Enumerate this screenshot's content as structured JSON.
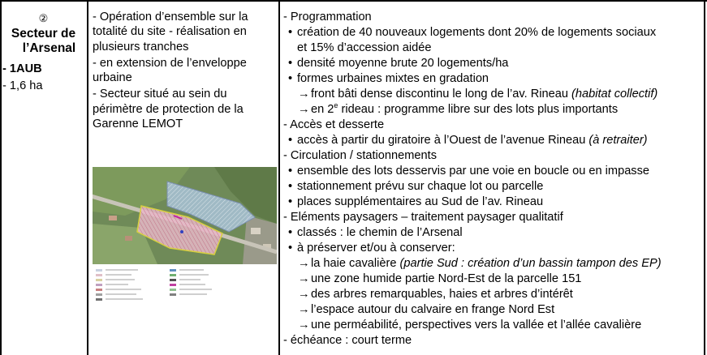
{
  "col1": {
    "number": "②",
    "title_line1": "Secteur de",
    "title_line2": "l’Arsenal",
    "zone": "- 1AUB",
    "area": "- 1,6 ha"
  },
  "col2": {
    "p1": "- Opération d’ensemble sur la totalité du site - réalisation en plusieurs tranches",
    "p2": "- en extension de l’enveloppe urbaine",
    "p3": "- Secteur situé au sein du périmètre de protection de la Garenne LEMOT"
  },
  "col3": {
    "programmation": {
      "heading": "- Programmation",
      "b1_line1": "création de 40 nouveaux logements dont 20% de logements sociaux",
      "b1_line2": "et 15% d’accession aidée",
      "b2": "densité moyenne brute 20 logements/ha",
      "b3": "formes urbaines mixtes en gradation",
      "a1_text": "front bâti dense discontinu le long de l’av. Rineau ",
      "a1_italic": "(habitat collectif)",
      "a2_pre": "en 2",
      "a2_sup": "e",
      "a2_text": " rideau : programme libre sur des lots plus importants"
    },
    "acces": {
      "heading": "- Accès et desserte",
      "b1_text": "accès à partir du giratoire à l’Ouest de l’avenue Rineau ",
      "b1_italic": "(à retraiter)"
    },
    "circulation": {
      "heading": "- Circulation / stationnements",
      "b1": "ensemble des lots desservis par une voie en boucle ou en impasse",
      "b2": "stationnement prévu sur chaque lot ou parcelle",
      "b3": "places supplémentaires au Sud de l’av. Rineau"
    },
    "paysage": {
      "heading": "- Eléments paysagers – traitement paysager qualitatif",
      "b1": "classés : le chemin de l’Arsenal",
      "b2": "à préserver et/ou à conserver:",
      "a1_text": "la haie cavalière ",
      "a1_italic": "(partie Sud : création d’un bassin tampon des EP)",
      "a2": "une zone humide partie Nord-Est de la parcelle 151",
      "a3": "des arbres remarquables, haies et arbres d’intérêt",
      "a4": "l’espace autour du calvaire en frange Nord Est",
      "a5": "une perméabilité, perspectives vers la vallée et l’allée cavalière"
    },
    "echeance": "- échéance : court terme"
  },
  "glyphs": {
    "bullet": "•",
    "arrow": "→"
  }
}
